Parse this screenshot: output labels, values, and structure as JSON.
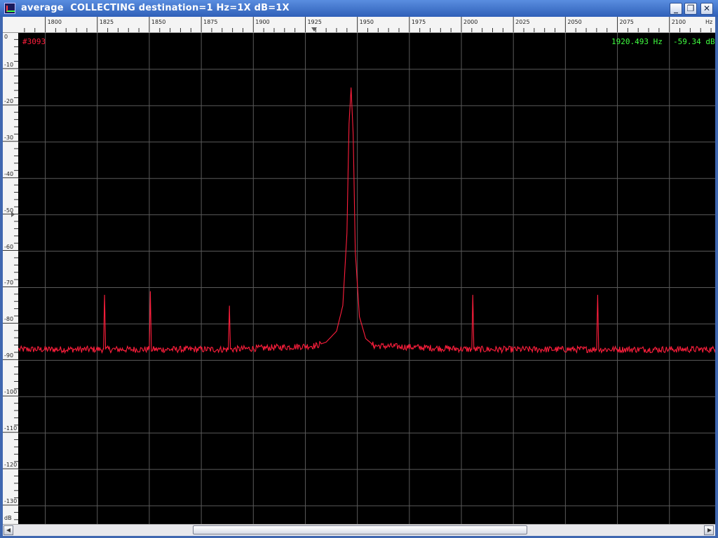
{
  "window": {
    "title": "average  COLLECTING destination=1 Hz=1X dB=1X",
    "buttons": {
      "minimize": "_",
      "maximize": "❐",
      "close": "✕"
    }
  },
  "axes": {
    "x_ticks": [
      "1800",
      "1825",
      "1850",
      "1875",
      "1900",
      "1925",
      "1950",
      "1975",
      "2000",
      "2025",
      "2050",
      "2075",
      "2100"
    ],
    "x_unit": "Hz",
    "y_ticks": [
      "0",
      "-10",
      "-20",
      "-30",
      "-40",
      "-50",
      "-60",
      "-70",
      "-80",
      "-90",
      "-100",
      "-110",
      "-120",
      "-130"
    ],
    "y_unit": "dB"
  },
  "readouts": {
    "counter": "#3093",
    "cursor_freq": "1920.493 Hz",
    "cursor_db": "-59.34 dB"
  },
  "colors": {
    "trace": "#ff1e3c",
    "readout": "#40ff40",
    "grid": "#5a5a5a",
    "background": "#000000"
  },
  "chart_data": {
    "type": "line",
    "xlim": [
      1787,
      2122
    ],
    "ylim": [
      -135,
      0
    ],
    "grid": true,
    "noise_floor": -87,
    "series": [
      {
        "values": [
          {
            "x": 1787,
            "y": -87
          },
          {
            "x": 1828,
            "y": -87
          },
          {
            "x": 1828.5,
            "y": -72
          },
          {
            "x": 1829,
            "y": -87
          },
          {
            "x": 1850,
            "y": -87
          },
          {
            "x": 1850.5,
            "y": -71
          },
          {
            "x": 1851,
            "y": -87
          },
          {
            "x": 1888,
            "y": -87
          },
          {
            "x": 1888.5,
            "y": -75
          },
          {
            "x": 1889,
            "y": -87
          },
          {
            "x": 1930,
            "y": -86
          },
          {
            "x": 1935,
            "y": -85
          },
          {
            "x": 1940,
            "y": -82
          },
          {
            "x": 1943,
            "y": -75
          },
          {
            "x": 1945,
            "y": -55
          },
          {
            "x": 1946,
            "y": -25
          },
          {
            "x": 1947,
            "y": -15
          },
          {
            "x": 1948,
            "y": -28
          },
          {
            "x": 1949,
            "y": -60
          },
          {
            "x": 1951,
            "y": -78
          },
          {
            "x": 1954,
            "y": -84
          },
          {
            "x": 1958,
            "y": -86
          },
          {
            "x": 2005,
            "y": -87
          },
          {
            "x": 2005.5,
            "y": -72
          },
          {
            "x": 2006,
            "y": -87
          },
          {
            "x": 2065,
            "y": -87
          },
          {
            "x": 2065.5,
            "y": -72
          },
          {
            "x": 2066,
            "y": -87
          },
          {
            "x": 2122,
            "y": -87
          }
        ]
      }
    ]
  }
}
